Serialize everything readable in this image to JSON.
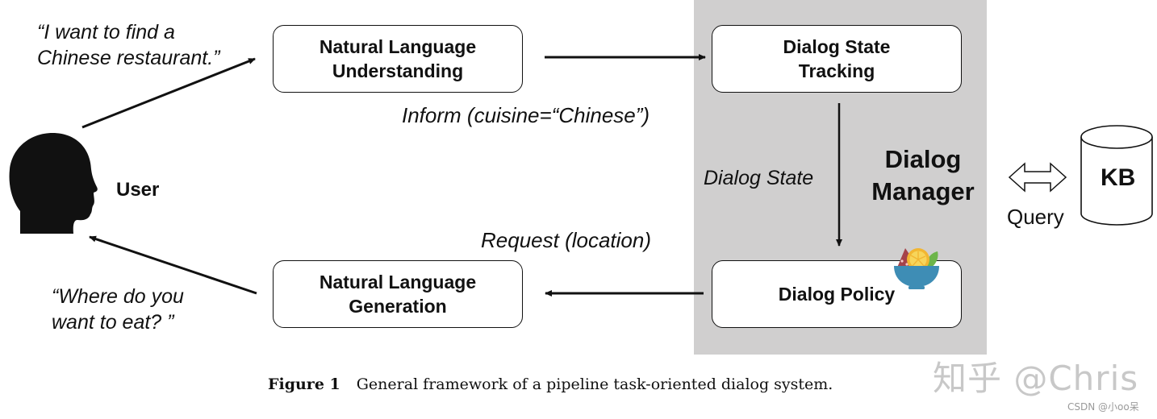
{
  "diagram": {
    "user_label": "User",
    "user_utterance": "“I want to find a\nChinese restaurant.”",
    "system_utterance": "“Where do you\n  want to eat? ”",
    "nlu_box": "Natural Language\nUnderstanding",
    "nlg_box": "Natural Language\nGeneration",
    "dst_box": "Dialog State\nTracking",
    "policy_box": "Dialog Policy",
    "inform_label": "Inform (cuisine=“Chinese”)",
    "dialog_state_label": "Dialog State",
    "request_label": "Request (location)",
    "dialog_manager_label": "Dialog\nManager",
    "kb_label": "KB",
    "query_label": "Query",
    "panel_color": "#d0cfcf"
  },
  "caption": {
    "figure_label": "Figure 1",
    "text": "General framework of a pipeline task-oriented dialog system."
  },
  "watermarks": {
    "zhihu": "知乎 @Chris",
    "csdn": "CSDN @小oo呆"
  }
}
